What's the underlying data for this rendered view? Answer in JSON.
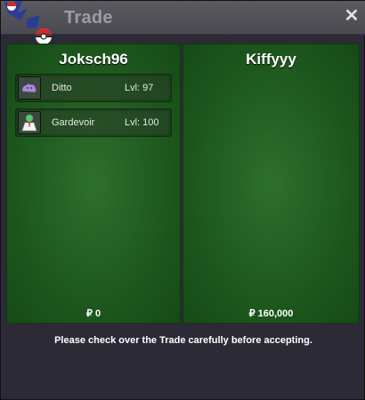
{
  "window": {
    "title": "Trade",
    "close_glyph": "✕"
  },
  "left_player": {
    "name": "Joksch96",
    "items": [
      {
        "name": "Ditto",
        "level": "Lvl: 97",
        "icon": "ditto-icon"
      },
      {
        "name": "Gardevoir",
        "level": "Lvl: 100",
        "icon": "gardevoir-icon"
      }
    ],
    "money": "₽ 0"
  },
  "right_player": {
    "name": "Kiffyyy",
    "items": [],
    "money": "₽ 160,000"
  },
  "notice": "Please check over the Trade carefully before accepting.",
  "colors": {
    "pane_green": "#2e6f2e",
    "titlebar": "#4f4f55",
    "background": "#2c2a36"
  }
}
